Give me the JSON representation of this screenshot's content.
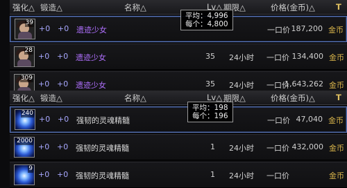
{
  "headers": {
    "enhance": "强化△",
    "forge": "锻造△",
    "name": "名称△",
    "level": "Lv△",
    "period": "期限△",
    "price": "价格(金币)△",
    "pin": "T"
  },
  "table1": {
    "rows": [
      {
        "count": "39",
        "enhance": "+0",
        "forge": "+0",
        "name": "遗迹少女",
        "level": "",
        "period": "",
        "trade": "一口价",
        "price": "187,200",
        "currency": "金币"
      },
      {
        "count": "28",
        "enhance": "+0",
        "forge": "+0",
        "name": "遗迹少女",
        "level": "35",
        "period": "24小时",
        "trade": "一口价",
        "price": "134,400",
        "currency": "金币"
      },
      {
        "count": "309",
        "enhance": "+0",
        "forge": "+0",
        "name": "遗迹少女",
        "level": "35",
        "period": "24小时",
        "trade": "一口价",
        "price": "1,643,262",
        "currency": "金币"
      }
    ],
    "tooltip": {
      "avg": "平均：4,996",
      "each": "每个：4,800"
    }
  },
  "table2": {
    "rows": [
      {
        "count": "240",
        "enhance": "+0",
        "forge": "+0",
        "name": "强韧的灵魂精髓",
        "level": "",
        "period": "",
        "trade": "一口价",
        "price": "47,040",
        "currency": "金币"
      },
      {
        "count": "2000",
        "enhance": "+0",
        "forge": "+0",
        "name": "强韧的灵魂精髓",
        "level": "1",
        "period": "24小时",
        "trade": "一口价",
        "price": "432,000",
        "currency": "金币"
      },
      {
        "count": "9",
        "enhance": "+0",
        "forge": "+0",
        "name": "强韧的灵魂精髓",
        "level": "1",
        "period": "24小时",
        "trade": "一口价",
        "price": "",
        "currency": "金币"
      }
    ],
    "tooltip": {
      "avg": "平均：198",
      "each": "每个：196"
    }
  }
}
